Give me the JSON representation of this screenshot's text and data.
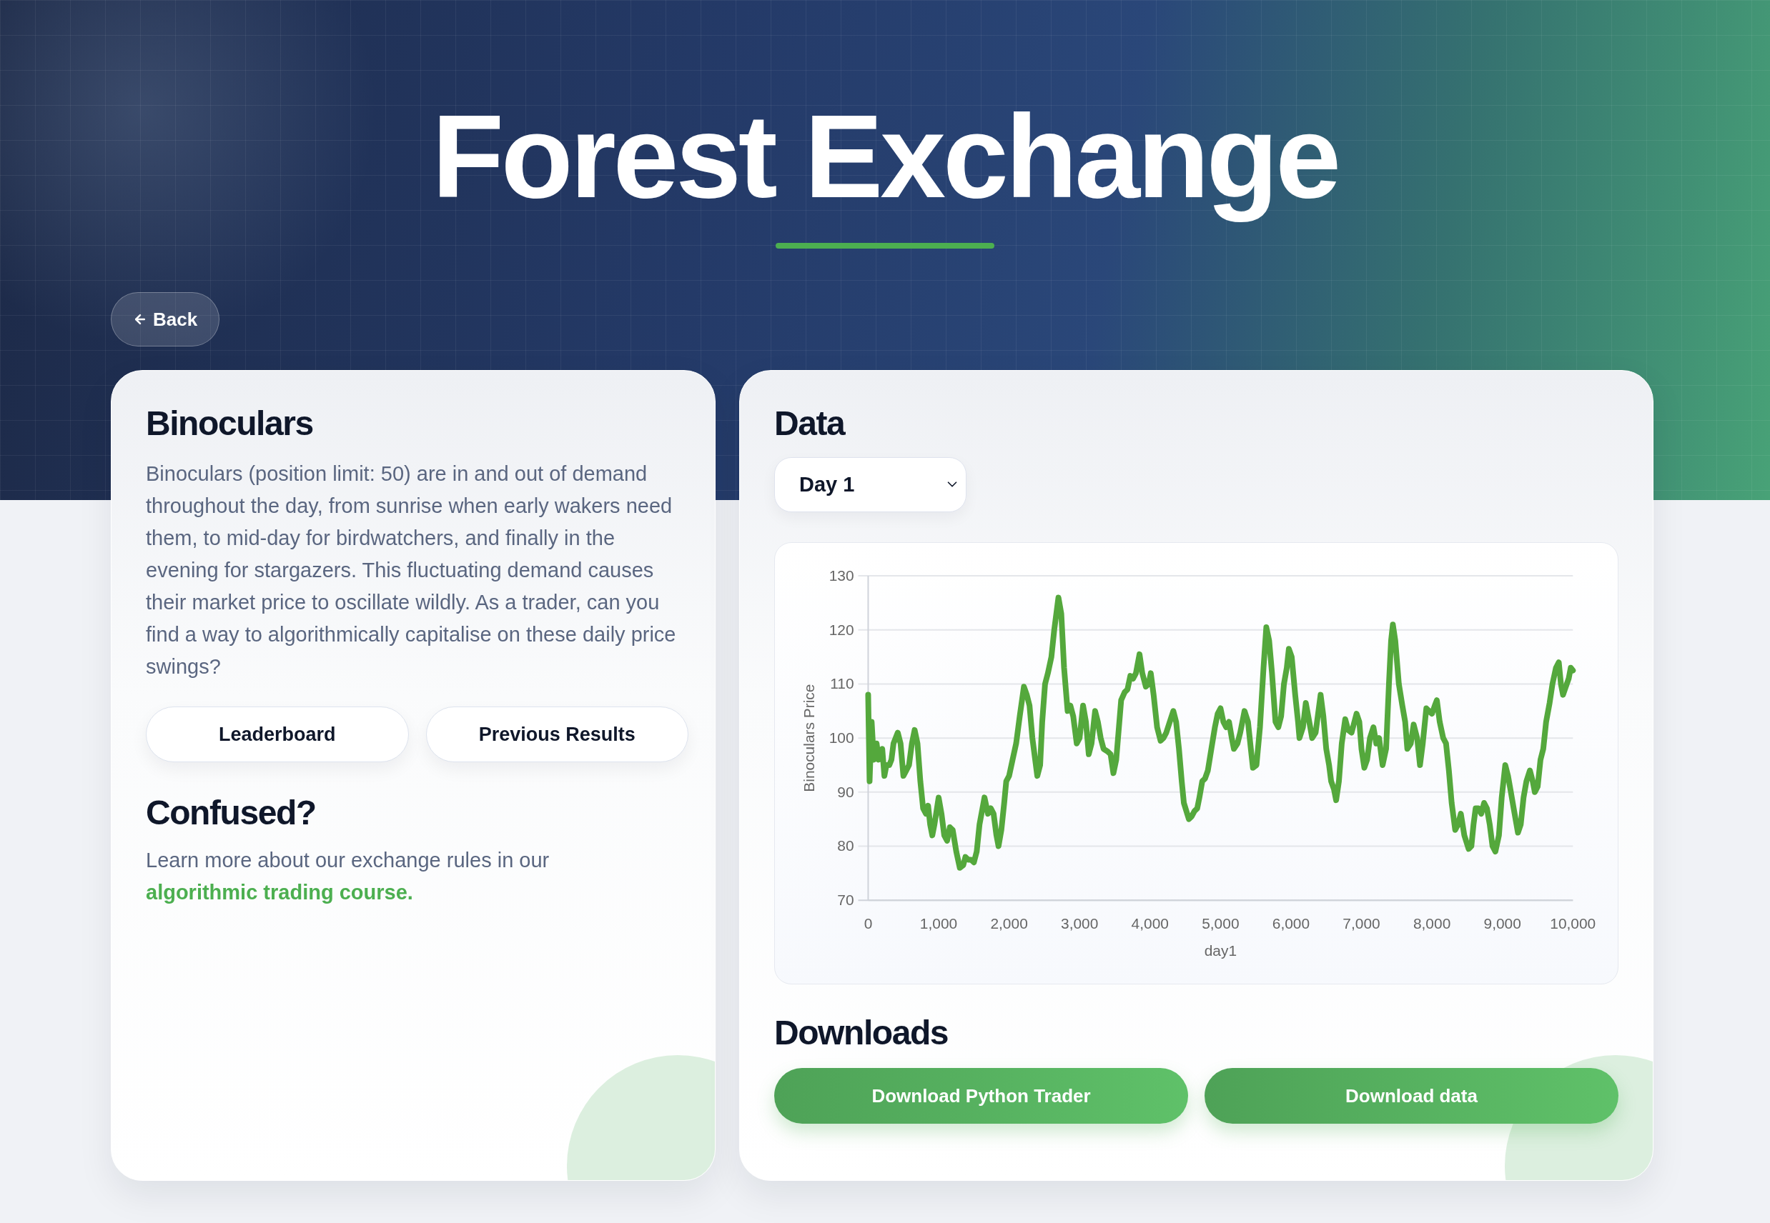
{
  "header": {
    "title": "Forest Exchange"
  },
  "back_button": {
    "label": "Back"
  },
  "product": {
    "title": "Binoculars",
    "description": "Binoculars (position limit: 50) are in and out of demand throughout the day, from sunrise when early wakers need them, to mid-day for birdwatchers, and finally in the evening for stargazers. This fluctuating demand causes their market price to oscillate wildly. As a trader, can you find a way to algorithmically capitalise on these daily price swings?",
    "buttons": [
      {
        "label": "Leaderboard"
      },
      {
        "label": "Previous Results"
      }
    ]
  },
  "help": {
    "title": "Confused?",
    "text": "Learn more about our exchange rules in our",
    "link": "algorithmic trading course."
  },
  "data": {
    "title": "Data",
    "select": {
      "value": "Day 1"
    },
    "chart_data": {
      "type": "line",
      "grid": true,
      "xlabel": "day1",
      "ylabel": "Binoculars Price",
      "x": [
        0,
        20,
        50,
        80,
        120,
        150,
        200,
        230,
        260,
        300,
        330,
        360,
        420,
        460,
        500,
        540,
        580,
        620,
        660,
        700,
        740,
        780,
        820,
        850,
        880,
        910,
        940,
        1000,
        1040,
        1080,
        1120,
        1160,
        1200,
        1250,
        1300,
        1350,
        1380,
        1420,
        1460,
        1500,
        1540,
        1580,
        1650,
        1700,
        1740,
        1780,
        1820,
        1850,
        1890,
        1930,
        1960,
        2000,
        2050,
        2100,
        2150,
        2210,
        2250,
        2290,
        2330,
        2400,
        2440,
        2470,
        2510,
        2550,
        2600,
        2640,
        2700,
        2740,
        2780,
        2830,
        2870,
        2910,
        2960,
        3000,
        3050,
        3090,
        3130,
        3170,
        3220,
        3260,
        3300,
        3340,
        3400,
        3440,
        3480,
        3520,
        3590,
        3640,
        3680,
        3720,
        3760,
        3800,
        3850,
        3890,
        3940,
        3980,
        4010,
        4050,
        4100,
        4150,
        4190,
        4230,
        4280,
        4330,
        4370,
        4410,
        4450,
        4480,
        4550,
        4590,
        4630,
        4670,
        4700,
        4740,
        4780,
        4820,
        4870,
        4920,
        4960,
        5000,
        5040,
        5080,
        5120,
        5160,
        5190,
        5240,
        5280,
        5340,
        5390,
        5430,
        5460,
        5510,
        5560,
        5610,
        5650,
        5690,
        5730,
        5780,
        5820,
        5860,
        5900,
        5940,
        5970,
        6010,
        6060,
        6100,
        6120,
        6170,
        6210,
        6260,
        6300,
        6350,
        6420,
        6460,
        6500,
        6540,
        6570,
        6610,
        6640,
        6680,
        6720,
        6770,
        6810,
        6860,
        6930,
        6970,
        7000,
        7040,
        7080,
        7120,
        7170,
        7210,
        7250,
        7280,
        7300,
        7350,
        7390,
        7420,
        7445,
        7480,
        7530,
        7580,
        7620,
        7650,
        7700,
        7740,
        7790,
        7830,
        7870,
        7920,
        7960,
        8000,
        8040,
        8070,
        8110,
        8160,
        8200,
        8240,
        8280,
        8330,
        8370,
        8410,
        8460,
        8520,
        8560,
        8590,
        8620,
        8660,
        8700,
        8740,
        8780,
        8820,
        8860,
        8900,
        8950,
        8990,
        9040,
        9080,
        9120,
        9160,
        9220,
        9260,
        9300,
        9340,
        9390,
        9430,
        9460,
        9500,
        9540,
        9580,
        9620,
        9670,
        9710,
        9760,
        9800,
        9830,
        9860,
        9900,
        9940,
        9970,
        10000
      ],
      "series": [
        {
          "color": "#54a83c",
          "values": [
            108,
            92,
            103,
            96,
            99,
            96,
            98,
            93,
            95,
            95,
            96,
            99,
            101,
            99,
            93,
            94,
            95,
            99,
            101.5,
            99,
            92,
            87,
            86,
            87.5,
            84,
            82,
            84,
            89,
            86,
            82,
            81,
            83.5,
            83,
            79,
            76,
            76.5,
            78,
            77.5,
            77.5,
            77,
            79,
            84,
            89,
            86,
            87,
            86,
            82,
            80,
            83,
            88,
            92,
            93,
            96,
            99,
            104,
            109.5,
            108,
            106,
            100,
            93,
            95,
            103,
            110,
            112,
            115,
            120,
            126,
            123,
            113,
            105,
            106,
            104,
            99,
            100,
            106,
            103,
            97,
            99,
            105,
            103,
            100,
            98,
            97.5,
            97,
            93.5,
            96,
            107,
            108.5,
            109,
            111.5,
            111,
            112,
            115.5,
            112,
            109.5,
            110,
            112,
            108,
            102,
            99.5,
            100,
            101,
            103,
            105,
            103,
            98,
            92,
            88,
            85,
            85.5,
            86.5,
            87,
            89,
            92,
            92.5,
            94,
            98,
            102,
            104.5,
            105.5,
            103,
            102,
            103,
            100,
            98,
            99,
            101,
            105,
            103,
            98,
            94.5,
            95,
            102,
            113,
            120.5,
            118,
            112,
            103,
            102,
            104,
            110,
            113,
            116.5,
            115,
            108,
            103,
            100,
            102,
            106.5,
            103,
            100,
            101,
            108,
            104,
            98,
            95,
            92,
            90.5,
            88.5,
            92,
            99,
            103.5,
            101.5,
            101,
            104.5,
            103,
            98,
            94.5,
            96,
            100,
            102,
            99,
            100,
            97,
            95,
            98,
            110,
            118,
            121,
            118,
            110,
            106,
            103,
            98,
            99,
            102.5,
            100,
            95,
            99,
            105.5,
            105,
            104.5,
            106,
            107,
            103,
            100,
            99,
            94,
            88,
            83,
            84,
            86,
            82,
            79.5,
            80,
            84,
            87,
            87,
            86,
            88,
            87,
            84,
            80,
            79,
            82,
            89,
            95,
            93,
            90,
            87,
            82.5,
            84,
            89,
            92,
            94,
            92,
            90,
            91,
            96,
            98,
            103,
            106.5,
            110,
            113,
            114,
            110,
            108,
            109.5,
            111,
            113,
            112.5
          ]
        }
      ],
      "xlim": [
        0,
        10000
      ],
      "ylim": [
        70,
        130
      ],
      "xticks": [
        {
          "value": 0,
          "label": "0"
        },
        {
          "value": 1000,
          "label": "1,000"
        },
        {
          "value": 2000,
          "label": "2,000"
        },
        {
          "value": 3000,
          "label": "3,000"
        },
        {
          "value": 4000,
          "label": "4,000"
        },
        {
          "value": 5000,
          "label": "5,000"
        },
        {
          "value": 6000,
          "label": "6,000"
        },
        {
          "value": 7000,
          "label": "7,000"
        },
        {
          "value": 8000,
          "label": "8,000"
        },
        {
          "value": 9000,
          "label": "9,000"
        },
        {
          "value": 10000,
          "label": "10,000"
        }
      ],
      "yticks": [
        70,
        80,
        90,
        100,
        110,
        120,
        130
      ]
    }
  },
  "downloads": {
    "title": "Downloads",
    "buttons": [
      {
        "label": "Download Python Trader"
      },
      {
        "label": "Download data"
      }
    ]
  }
}
